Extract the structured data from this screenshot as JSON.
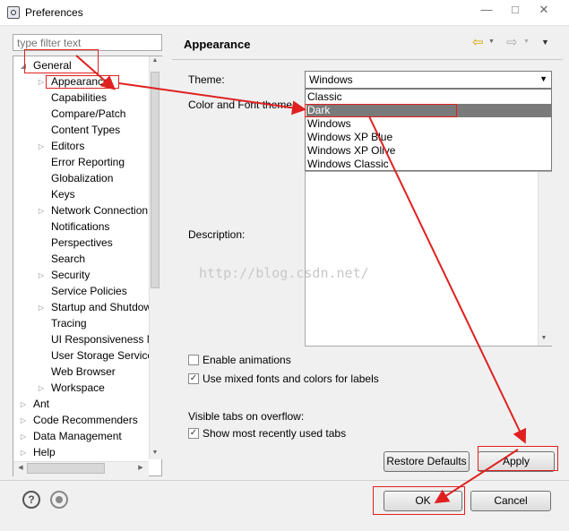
{
  "window": {
    "title": "Preferences",
    "minimize": "—",
    "maximize": "□",
    "close": "✕"
  },
  "filter": {
    "placeholder": "type filter text"
  },
  "tree": [
    {
      "label": "General",
      "state": "expanded",
      "indent": 0
    },
    {
      "label": "Appearance",
      "state": "collapsed",
      "indent": 1,
      "selected": true
    },
    {
      "label": "Capabilities",
      "state": "leaf",
      "indent": 1
    },
    {
      "label": "Compare/Patch",
      "state": "leaf",
      "indent": 1
    },
    {
      "label": "Content Types",
      "state": "leaf",
      "indent": 1
    },
    {
      "label": "Editors",
      "state": "collapsed",
      "indent": 1
    },
    {
      "label": "Error Reporting",
      "state": "leaf",
      "indent": 1
    },
    {
      "label": "Globalization",
      "state": "leaf",
      "indent": 1
    },
    {
      "label": "Keys",
      "state": "leaf",
      "indent": 1
    },
    {
      "label": "Network Connection",
      "state": "collapsed",
      "indent": 1
    },
    {
      "label": "Notifications",
      "state": "leaf",
      "indent": 1
    },
    {
      "label": "Perspectives",
      "state": "leaf",
      "indent": 1
    },
    {
      "label": "Search",
      "state": "leaf",
      "indent": 1
    },
    {
      "label": "Security",
      "state": "collapsed",
      "indent": 1
    },
    {
      "label": "Service Policies",
      "state": "leaf",
      "indent": 1
    },
    {
      "label": "Startup and Shutdown",
      "state": "collapsed",
      "indent": 1
    },
    {
      "label": "Tracing",
      "state": "leaf",
      "indent": 1
    },
    {
      "label": "UI Responsiveness M",
      "state": "leaf",
      "indent": 1
    },
    {
      "label": "User Storage Service",
      "state": "leaf",
      "indent": 1
    },
    {
      "label": "Web Browser",
      "state": "leaf",
      "indent": 1
    },
    {
      "label": "Workspace",
      "state": "collapsed",
      "indent": 1
    },
    {
      "label": "Ant",
      "state": "collapsed",
      "indent": 0
    },
    {
      "label": "Code Recommenders",
      "state": "collapsed",
      "indent": 0
    },
    {
      "label": "Data Management",
      "state": "collapsed",
      "indent": 0
    },
    {
      "label": "Help",
      "state": "collapsed",
      "indent": 0
    }
  ],
  "page": {
    "title": "Appearance",
    "nav_back": "⇦",
    "nav_forward": "⇨",
    "nav_menu": "▼",
    "theme_label": "Theme:",
    "theme_value": "Windows",
    "color_font_label": "Color and Font theme:",
    "theme_options": [
      "Classic",
      "Dark",
      "Windows",
      "Windows XP Blue",
      "Windows XP Olive",
      "Windows Classic"
    ],
    "theme_highlighted": "Dark",
    "description_label": "Description:",
    "enable_animations": {
      "label": "Enable animations",
      "checked": false
    },
    "mixed_fonts": {
      "label": "Use mixed fonts and colors for labels",
      "checked": true
    },
    "visible_tabs_label": "Visible tabs on overflow:",
    "show_recent_tabs": {
      "label": "Show most recently used tabs",
      "checked": true
    },
    "restore_defaults": "Restore Defaults",
    "apply": "Apply"
  },
  "footer": {
    "help_icon": "?",
    "ok": "OK",
    "cancel": "Cancel"
  },
  "watermark": "http://blog.csdn.net/",
  "colors": {
    "annotation_red": "#e02020",
    "selection": "#7a7a7a"
  }
}
